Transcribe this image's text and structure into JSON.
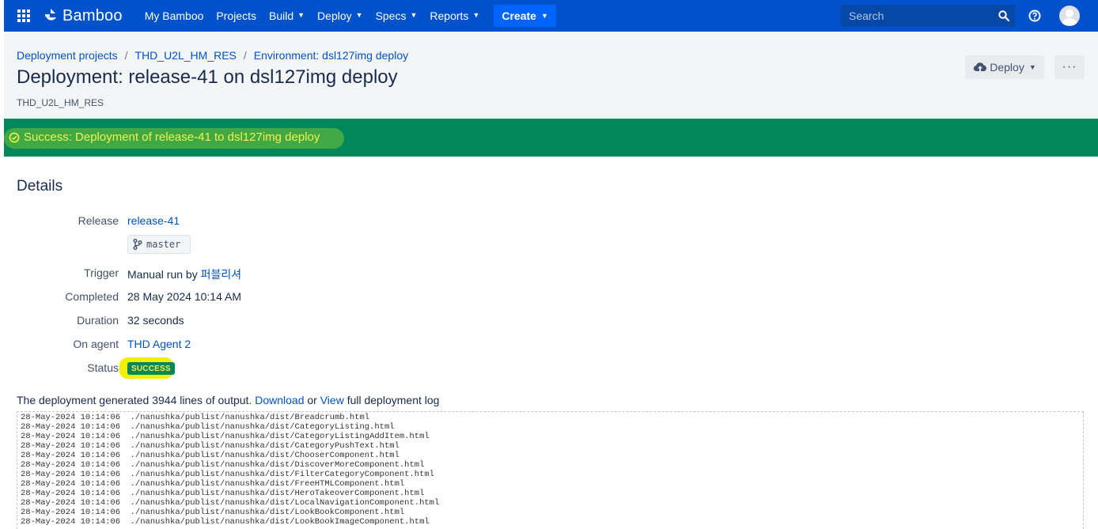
{
  "app": {
    "name": "Bamboo",
    "nav": [
      {
        "label": "My Bamboo",
        "dropdown": false
      },
      {
        "label": "Projects",
        "dropdown": false
      },
      {
        "label": "Build",
        "dropdown": true
      },
      {
        "label": "Deploy",
        "dropdown": true
      },
      {
        "label": "Specs",
        "dropdown": true
      },
      {
        "label": "Reports",
        "dropdown": true
      }
    ],
    "create_label": "Create",
    "search_placeholder": "Search"
  },
  "header": {
    "breadcrumb": [
      "Deployment projects",
      "THD_U2L_HM_RES",
      "Environment: dsl127img deploy"
    ],
    "title": "Deployment: release-41 on dsl127img deploy",
    "project": "THD_U2L_HM_RES",
    "deploy_button": "Deploy",
    "more_button": "···"
  },
  "banner": {
    "text": "Success: Deployment of release-41 to dsl127img deploy",
    "color": "#00875a"
  },
  "details": {
    "title": "Details",
    "release_label": "Release",
    "release_value": "release-41",
    "branch": "master",
    "trigger_label": "Trigger",
    "trigger_text": "Manual run by",
    "trigger_user": "퍼블리셔",
    "completed_label": "Completed",
    "completed_value": "28 May 2024 10:14 AM",
    "duration_label": "Duration",
    "duration_value": "32 seconds",
    "agent_label": "On agent",
    "agent_value": "THD Agent 2",
    "status_label": "Status",
    "status_value": "SUCCESS"
  },
  "output": {
    "prefix": "The deployment generated 3944 lines of output.",
    "download": "Download",
    "or": "or",
    "view": "View",
    "suffix": "full deployment log"
  },
  "log_lines": [
    "28-May-2024 10:14:06  ./nanushka/publist/nanushka/dist/Breadcrumb.html",
    "28-May-2024 10:14:06  ./nanushka/publist/nanushka/dist/CategoryListing.html",
    "28-May-2024 10:14:06  ./nanushka/publist/nanushka/dist/CategoryListingAddItem.html",
    "28-May-2024 10:14:06  ./nanushka/publist/nanushka/dist/CategoryPushText.html",
    "28-May-2024 10:14:06  ./nanushka/publist/nanushka/dist/ChooserComponent.html",
    "28-May-2024 10:14:06  ./nanushka/publist/nanushka/dist/DiscoverMoreComponent.html",
    "28-May-2024 10:14:06  ./nanushka/publist/nanushka/dist/FilterCategoryComponent.html",
    "28-May-2024 10:14:06  ./nanushka/publist/nanushka/dist/FreeHTMLComponent.html",
    "28-May-2024 10:14:06  ./nanushka/publist/nanushka/dist/HeroTakeoverComponent.html",
    "28-May-2024 10:14:06  ./nanushka/publist/nanushka/dist/LocalNavigationComponent.html",
    "28-May-2024 10:14:06  ./nanushka/publist/nanushka/dist/LookBookComponent.html",
    "28-May-2024 10:14:06  ./nanushka/publist/nanushka/dist/LookBookImageComponent.html"
  ]
}
